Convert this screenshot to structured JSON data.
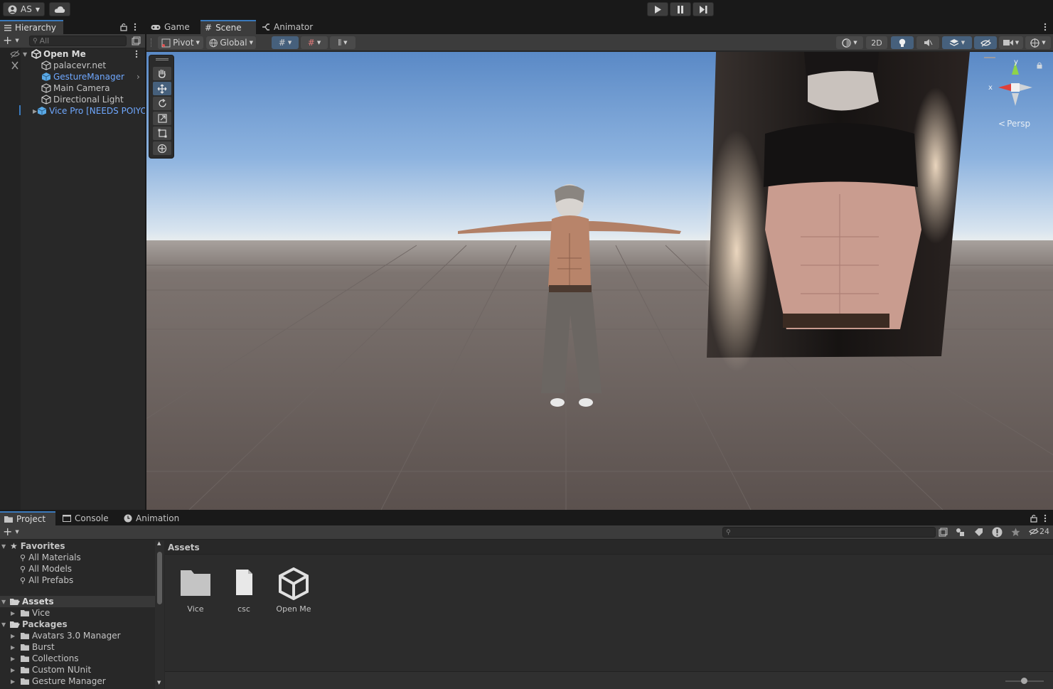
{
  "topbar": {
    "account_label": "AS",
    "play_icon": "play-icon",
    "pause_icon": "pause-icon",
    "step_icon": "step-icon"
  },
  "hierarchy": {
    "tab_label": "Hierarchy",
    "search_placeholder": "All",
    "items": [
      {
        "label": "Open Me",
        "icon": "unity-scene-icon",
        "bold": true
      },
      {
        "label": "palacevr.net",
        "icon": "gameobject-icon"
      },
      {
        "label": "GestureManager",
        "icon": "prefab-icon",
        "prefab": true
      },
      {
        "label": "Main Camera",
        "icon": "gameobject-icon"
      },
      {
        "label": "Directional Light",
        "icon": "gameobject-icon"
      },
      {
        "label": "Vice Pro [NEEDS POIYOMI]",
        "icon": "prefab-icon",
        "prefab": true
      }
    ]
  },
  "scene": {
    "tabs": [
      {
        "label": "Game",
        "icon": "gamepad-icon"
      },
      {
        "label": "Scene",
        "icon": "grid-icon"
      },
      {
        "label": "Animator",
        "icon": "animator-icon"
      }
    ],
    "pivot_label": "Pivot",
    "global_label": "Global",
    "twod_label": "2D",
    "persp_label": "Persp",
    "axis_x": "x",
    "axis_y": "y",
    "tools": [
      "hand-tool-icon",
      "move-tool-icon",
      "rotate-tool-icon",
      "scale-tool-icon",
      "rect-tool-icon",
      "transform-tool-icon"
    ]
  },
  "project": {
    "tabs": [
      {
        "label": "Project",
        "icon": "folder-icon"
      },
      {
        "label": "Console",
        "icon": "console-icon"
      },
      {
        "label": "Animation",
        "icon": "clock-icon"
      }
    ],
    "favorites_label": "Favorites",
    "favorites": [
      "All Materials",
      "All Models",
      "All Prefabs"
    ],
    "assets_label": "Assets",
    "assets_children": [
      "Vice"
    ],
    "packages_label": "Packages",
    "packages": [
      "Avatars 3.0 Manager",
      "Burst",
      "Collections",
      "Custom NUnit",
      "Gesture Manager"
    ],
    "breadcrumb": "Assets",
    "hidden_count": "24",
    "grid_items": [
      {
        "label": "Vice",
        "icon": "folder-icon"
      },
      {
        "label": "csc",
        "icon": "file-icon"
      },
      {
        "label": "Open Me",
        "icon": "unity-scene-icon"
      }
    ]
  }
}
